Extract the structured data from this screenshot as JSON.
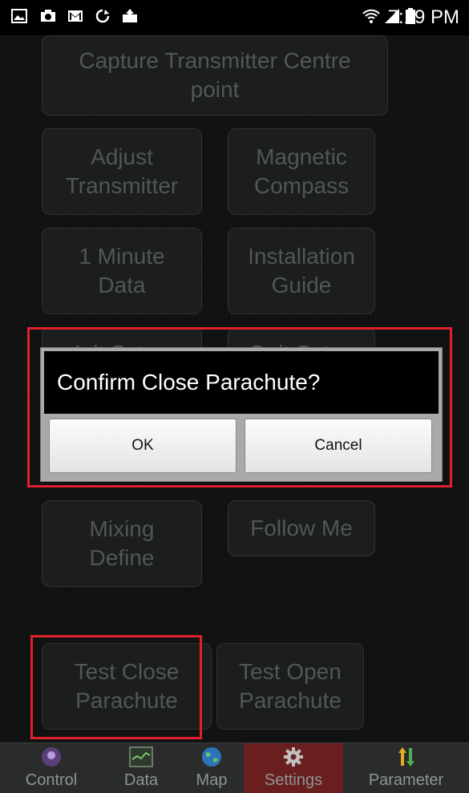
{
  "status_bar": {
    "time": "7:19 PM",
    "icons": [
      "gallery-icon",
      "camera-icon",
      "gmail-icon",
      "sync-icon",
      "upload-icon",
      "wifi-icon",
      "signal-icon",
      "battery-icon"
    ]
  },
  "settings_buttons": {
    "capture_centre": "Capture Transmitter Centre\npoint",
    "adjust_transmitter": "Adjust\nTransmitter",
    "magnetic_compass": "Magnetic\nCompass",
    "one_minute_data": "1 Minute\nData",
    "installation_guide": "Installation\nGuide",
    "init_setup": "Init Setup",
    "quit_setup": "Quit Setup",
    "mixing_define": "Mixing\nDefine",
    "follow_me": "Follow Me",
    "test_close_parachute": "Test Close\nParachute",
    "test_open_parachute": "Test Open\nParachute"
  },
  "dialog": {
    "title": "Confirm Close Parachute?",
    "ok_label": "OK",
    "cancel_label": "Cancel"
  },
  "nav": {
    "items": [
      {
        "label": "Control",
        "icon": "control-icon"
      },
      {
        "label": "Data",
        "icon": "data-icon"
      },
      {
        "label": "Map",
        "icon": "globe-icon"
      },
      {
        "label": "Settings",
        "icon": "gear-icon"
      },
      {
        "label": "Parameter",
        "icon": "arrows-icon"
      }
    ],
    "active": "Settings"
  },
  "colors": {
    "highlight": "#e0202a",
    "active_tab": "#6a1f1f",
    "background": "#1a1c1c"
  }
}
